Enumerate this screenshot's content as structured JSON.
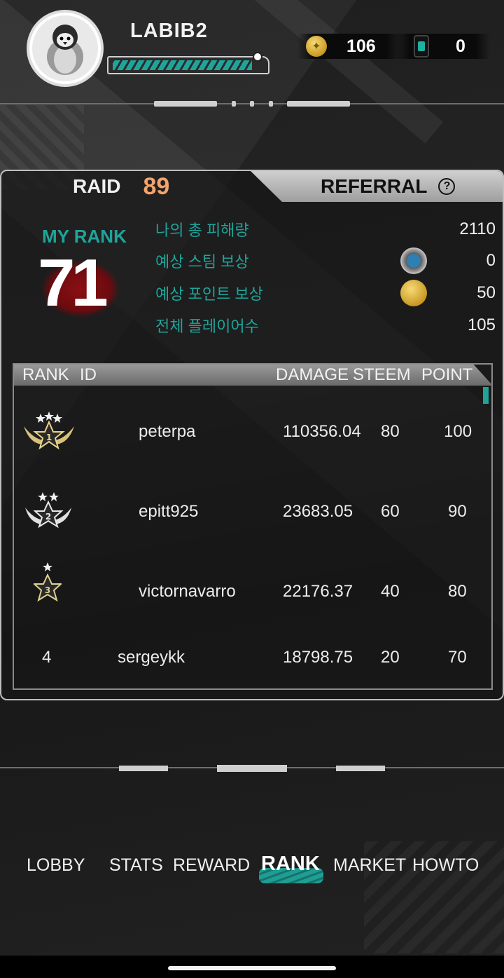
{
  "header": {
    "username": "LABIB2",
    "xp_progress": 0.92,
    "gold": "106",
    "tokens": "0"
  },
  "tabs": {
    "raid_label": "RAID",
    "raid_number": "89",
    "referral_label": "REFERRAL",
    "help_icon": "?"
  },
  "my_rank": {
    "label": "MY RANK",
    "value": "71"
  },
  "stats": [
    {
      "label": "나의 총 피해량",
      "value": "2110",
      "icon": ""
    },
    {
      "label": "예상 스팀 보상",
      "value": "0",
      "icon": "steem-icon"
    },
    {
      "label": "예상 포인트 보상",
      "value": "50",
      "icon": "gold-coin-icon"
    },
    {
      "label": "전체 플레이어수",
      "value": "105",
      "icon": ""
    }
  ],
  "table": {
    "headers": {
      "rank": "RANK",
      "id": "ID",
      "damage": "DAMAGE",
      "steem": "STEEM",
      "point": "POINT"
    },
    "rows": [
      {
        "rank": "1",
        "badge": "gold-winged-medal",
        "id": "peterpa",
        "damage": "110356.04",
        "steem": "80",
        "point": "100"
      },
      {
        "rank": "2",
        "badge": "silver-winged-medal",
        "id": "epitt925",
        "damage": "23683.05",
        "steem": "60",
        "point": "90"
      },
      {
        "rank": "3",
        "badge": "bronze-star-medal",
        "id": "victornavarro",
        "damage": "22176.37",
        "steem": "40",
        "point": "80"
      },
      {
        "rank": "4",
        "badge": "",
        "id": "sergeykk",
        "damage": "18798.75",
        "steem": "20",
        "point": "70"
      }
    ]
  },
  "nav": {
    "lobby": "LOBBY",
    "stats": "STATS",
    "reward": "REWARD",
    "rank": "RANK",
    "market": "MARKET",
    "howto": "HOWTO",
    "active": "RANK"
  },
  "colors": {
    "accent": "#1fa49a",
    "raid_number": "#f2a46b",
    "blood": "#8c0f14"
  }
}
